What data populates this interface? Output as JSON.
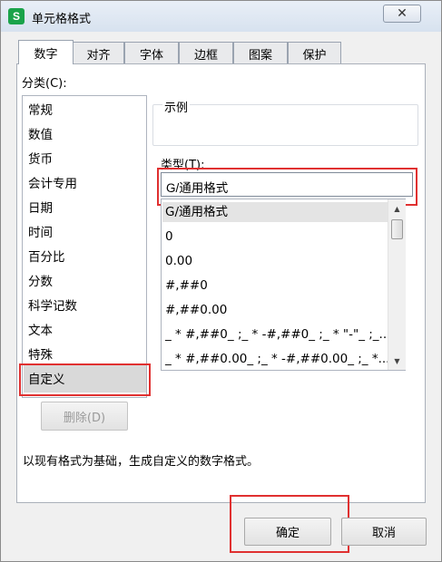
{
  "window": {
    "title": "单元格格式",
    "app_icon_letter": "S",
    "close_glyph": "✕"
  },
  "tabs": [
    "数字",
    "对齐",
    "字体",
    "边框",
    "图案",
    "保护"
  ],
  "category": {
    "label": "分类(C):",
    "items": [
      "常规",
      "数值",
      "货币",
      "会计专用",
      "日期",
      "时间",
      "百分比",
      "分数",
      "科学记数",
      "文本",
      "特殊",
      "自定义"
    ],
    "selected": "自定义"
  },
  "sample": {
    "label": "示例"
  },
  "type": {
    "label": "类型(T):",
    "value": "G/通用格式",
    "formats": [
      "G/通用格式",
      "0",
      "0.00",
      "#,##0",
      "#,##0.00",
      "_ * #,##0_ ;_ * -#,##0_ ;_ * \"-\"_ ;_...",
      "_ * #,##0.00_ ;_ * -#,##0.00_ ;_ *..."
    ]
  },
  "delete_button": "删除(D)",
  "description": "以现有格式为基础，生成自定义的数字格式。",
  "footer": {
    "ok": "确定",
    "cancel": "取消"
  },
  "scrollbar": {
    "up": "▲",
    "down": "▼"
  },
  "colors": {
    "highlight": "#e03030",
    "app_icon": "#1aa34a"
  }
}
